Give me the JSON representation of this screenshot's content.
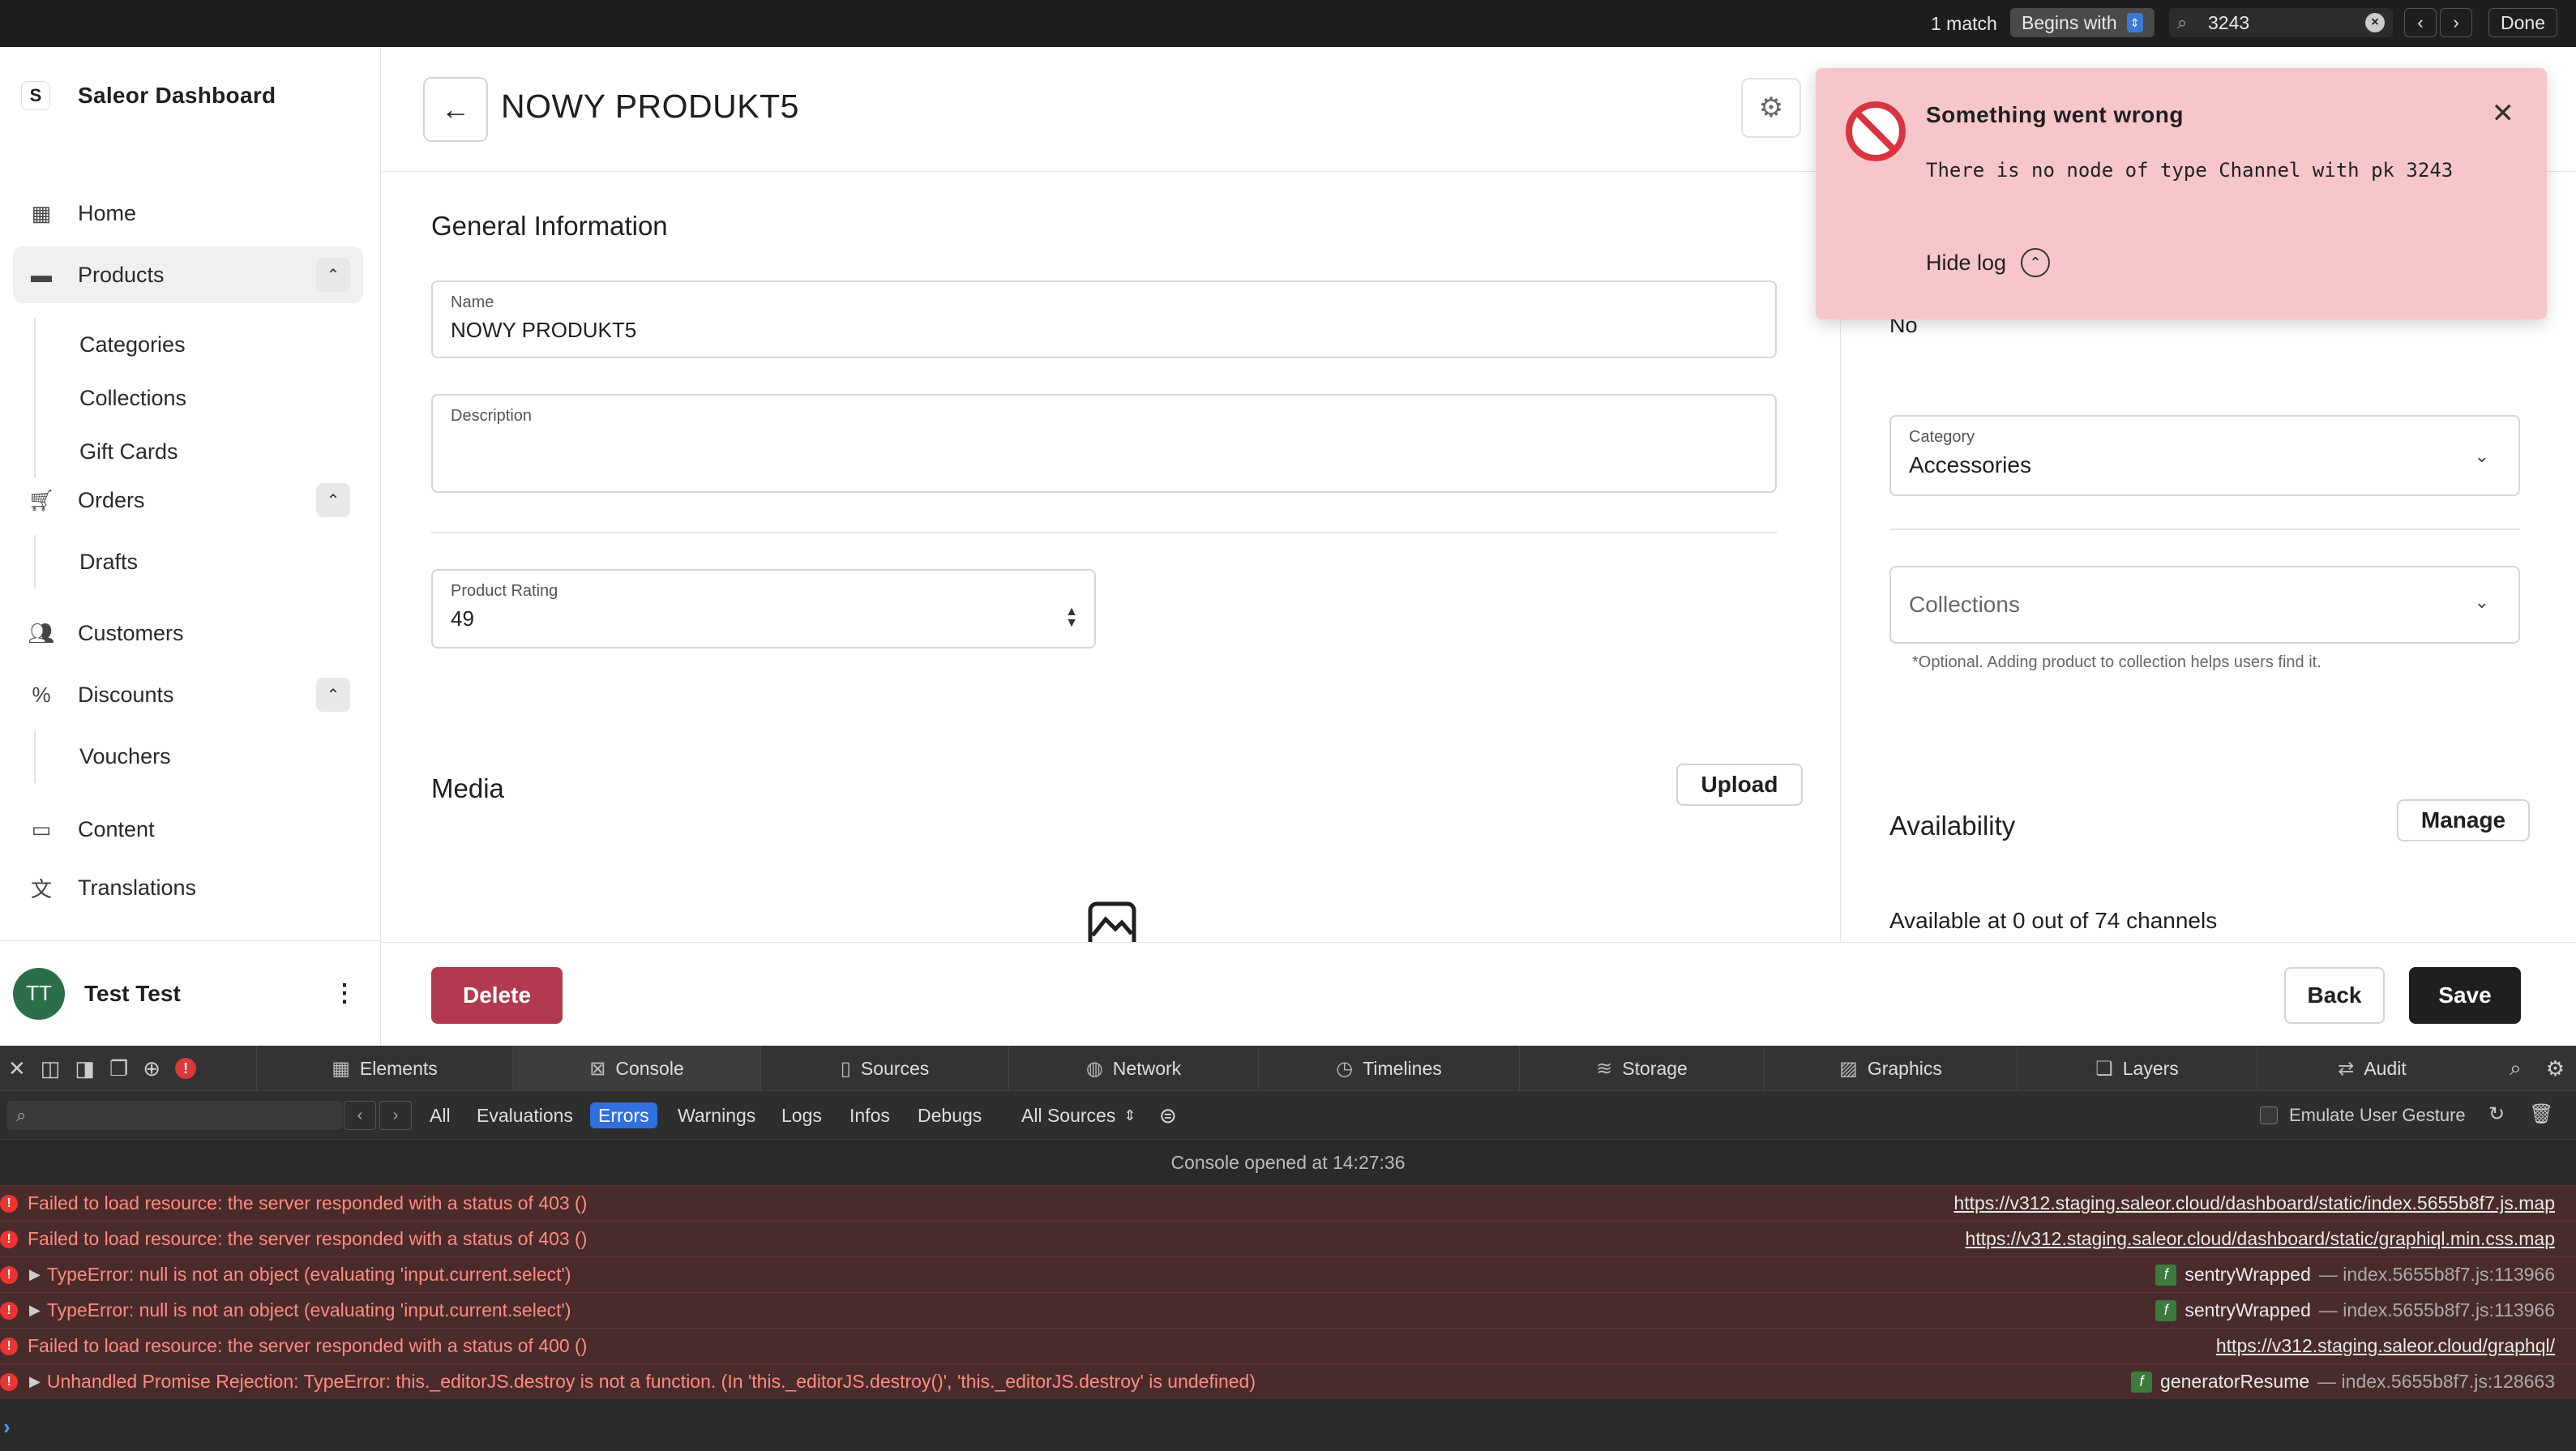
{
  "findbar": {
    "match_count": "1 match",
    "mode": "Begins with",
    "query": "3243",
    "done_label": "Done"
  },
  "sidebar": {
    "brand": "Saleor Dashboard",
    "logo_letter": "S",
    "items": {
      "home": "Home",
      "products": "Products",
      "categories": "Categories",
      "collections": "Collections",
      "gift_cards": "Gift Cards",
      "orders": "Orders",
      "drafts": "Drafts",
      "customers": "Customers",
      "discounts": "Discounts",
      "vouchers": "Vouchers",
      "content": "Content",
      "translations": "Translations"
    },
    "user": {
      "initials": "TT",
      "name": "Test Test"
    }
  },
  "header": {
    "title": "NOWY PRODUKT5"
  },
  "general": {
    "title": "General Information",
    "name_label": "Name",
    "name_value": "NOWY PRODUKT5",
    "description_label": "Description",
    "rating_label": "Product Rating",
    "rating_value": "49"
  },
  "media": {
    "title": "Media",
    "upload_label": "Upload"
  },
  "right_panel": {
    "partial_value": "No",
    "category_label": "Category",
    "category_value": "Accessories",
    "collections_placeholder": "Collections",
    "collections_hint": "*Optional. Adding product to collection helps users find it.",
    "availability_title": "Availability",
    "manage_label": "Manage",
    "availability_text": "Available at 0 out of 74 channels"
  },
  "toast": {
    "title": "Something went wrong",
    "message": "There is no node of type Channel with pk 3243",
    "hide_log": "Hide log"
  },
  "savebar": {
    "delete_label": "Delete",
    "back_label": "Back",
    "save_label": "Save"
  },
  "devtools": {
    "tabs": {
      "elements": "Elements",
      "console": "Console",
      "sources": "Sources",
      "network": "Network",
      "timelines": "Timelines",
      "storage": "Storage",
      "graphics": "Graphics",
      "layers": "Layers",
      "audit": "Audit"
    },
    "levels": {
      "all": "All",
      "evaluations": "Evaluations",
      "errors": "Errors",
      "warnings": "Warnings",
      "logs": "Logs",
      "infos": "Infos",
      "debugs": "Debugs",
      "sources": "All Sources"
    },
    "emulate_label": "Emulate User Gesture",
    "opened_text": "Console opened at 14:27:36",
    "rows": [
      {
        "msg": "Failed to load resource: the server responded with a status of 403 ()",
        "src": "https://v312.staging.saleor.cloud/dashboard/static/index.5655b8f7.js.map"
      },
      {
        "msg": "Failed to load resource: the server responded with a status of 403 ()",
        "src": "https://v312.staging.saleor.cloud/dashboard/static/graphiql.min.css.map"
      },
      {
        "msg": "TypeError: null is not an object (evaluating 'input.current.select')",
        "fn": "sentryWrapped",
        "loc": "— index.5655b8f7.js:113966"
      },
      {
        "msg": "TypeError: null is not an object (evaluating 'input.current.select')",
        "fn": "sentryWrapped",
        "loc": "— index.5655b8f7.js:113966"
      },
      {
        "msg": "Failed to load resource: the server responded with a status of 400 ()",
        "src": "https://v312.staging.saleor.cloud/graphql/"
      },
      {
        "msg": "Unhandled Promise Rejection: TypeError: this._editorJS.destroy is not a function. (In 'this._editorJS.destroy()', 'this._editorJS.destroy' is undefined)",
        "fn": "generatorResume",
        "loc": "— index.5655b8f7.js:128663"
      }
    ]
  },
  "colors": {
    "toast_bg": "#f6c6ca",
    "delete_bg": "#b3394e",
    "save_bg": "#1f1f1f",
    "error_row_bg": "#4a2b2b",
    "active_level": "#2f6fde"
  }
}
